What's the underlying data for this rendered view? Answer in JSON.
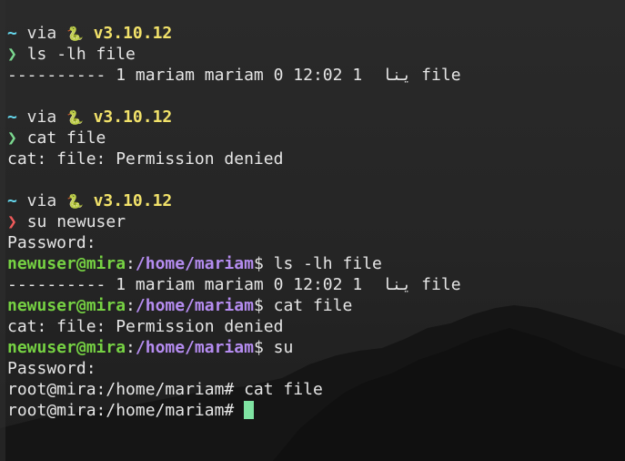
{
  "prompt": {
    "dir": "~",
    "via": " via ",
    "lang_icon": "🐍",
    "version": "v3.10.12",
    "arrow": "❯"
  },
  "session": [
    {
      "kind": "cmd",
      "arrow_state": "ok",
      "text": "ls -lh file"
    },
    {
      "kind": "out",
      "text": "---------- 1 mariam mariam 0 ينا  1 12:02 file"
    },
    {
      "kind": "blank"
    },
    {
      "kind": "cmd",
      "arrow_state": "ok",
      "text": "cat file"
    },
    {
      "kind": "out",
      "text": "cat: file: Permission denied"
    },
    {
      "kind": "blank"
    },
    {
      "kind": "cmd",
      "arrow_state": "error",
      "text": "su newuser"
    },
    {
      "kind": "out",
      "text": "Password:"
    },
    {
      "kind": "shell",
      "user": "newuser@mira",
      "sep": ":",
      "path": "/home/mariam",
      "sym": "$ ",
      "text": "ls -lh file"
    },
    {
      "kind": "out",
      "text": "---------- 1 mariam mariam 0 ينا  1 12:02 file"
    },
    {
      "kind": "shell",
      "user": "newuser@mira",
      "sep": ":",
      "path": "/home/mariam",
      "sym": "$ ",
      "text": "cat file"
    },
    {
      "kind": "out",
      "text": "cat: file: Permission denied"
    },
    {
      "kind": "shell",
      "user": "newuser@mira",
      "sep": ":",
      "path": "/home/mariam",
      "sym": "$ ",
      "text": "su"
    },
    {
      "kind": "out",
      "text": "Password:"
    },
    {
      "kind": "out",
      "text": "root@mira:/home/mariam# cat file"
    },
    {
      "kind": "active",
      "text": "root@mira:/home/mariam# "
    }
  ],
  "colors": {
    "background": "#262626",
    "tilde": "#66d9ef",
    "version": "#f2e26a",
    "arrow_ok": "#7bd88f",
    "arrow_error": "#ef5a5a",
    "user": "#76d243",
    "path": "#b58cf0",
    "cursor": "#7fe3a2"
  }
}
